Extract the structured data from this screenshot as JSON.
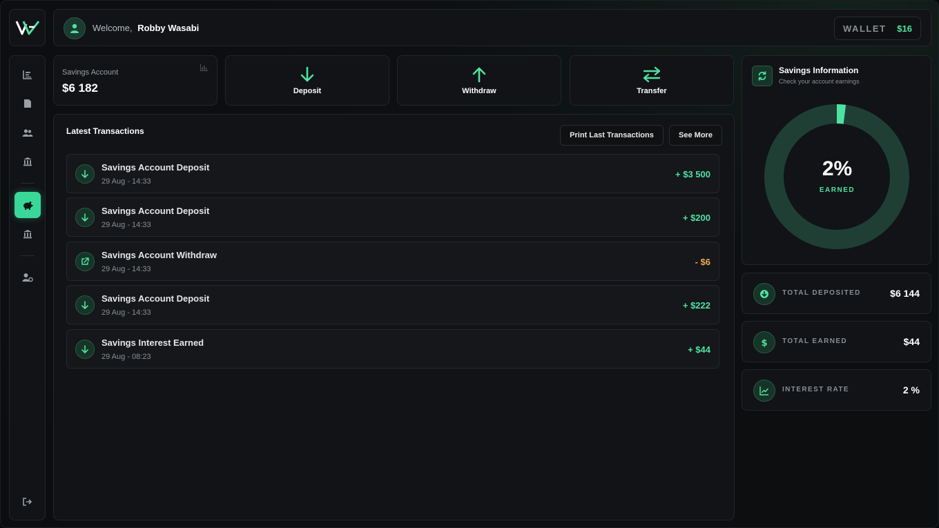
{
  "header": {
    "welcome_label": "Welcome,",
    "user_name": "Robby Wasabi",
    "wallet_label": "WALLET",
    "wallet_value": "$16"
  },
  "savings": {
    "label": "Savings Account",
    "value": "$6 182"
  },
  "actions": {
    "deposit": "Deposit",
    "withdraw": "Withdraw",
    "transfer": "Transfer"
  },
  "transactions": {
    "title": "Latest Transactions",
    "print_label": "Print Last Transactions",
    "see_more_label": "See More",
    "items": [
      {
        "name": "Savings Account Deposit",
        "date": "29 Aug - 14:33",
        "amount": "+ $3 500"
      },
      {
        "name": "Savings Account Deposit",
        "date": "29 Aug - 14:33",
        "amount": "+ $200"
      },
      {
        "name": "Savings Account Withdraw",
        "date": "29 Aug - 14:33",
        "amount": "- $6"
      },
      {
        "name": "Savings Account Deposit",
        "date": "29 Aug - 14:33",
        "amount": "+ $222"
      },
      {
        "name": "Savings Interest Earned",
        "date": "29 Aug - 08:23",
        "amount": "+ $44"
      }
    ]
  },
  "info": {
    "title": "Savings Information",
    "subtitle": "Check your account earnings",
    "percent_label": "2%",
    "earned_label": "EARNED",
    "fraction": 0.02
  },
  "stats": {
    "deposited_label": "TOTAL DEPOSITED",
    "deposited_value": "$6 144",
    "earned_label": "TOTAL EARNED",
    "earned_value": "$44",
    "rate_label": "INTEREST RATE",
    "rate_value": "2 %"
  },
  "colors": {
    "accent": "#4ee3a2",
    "negative": "#f2a65a",
    "donut_track": "#1f3f35"
  }
}
